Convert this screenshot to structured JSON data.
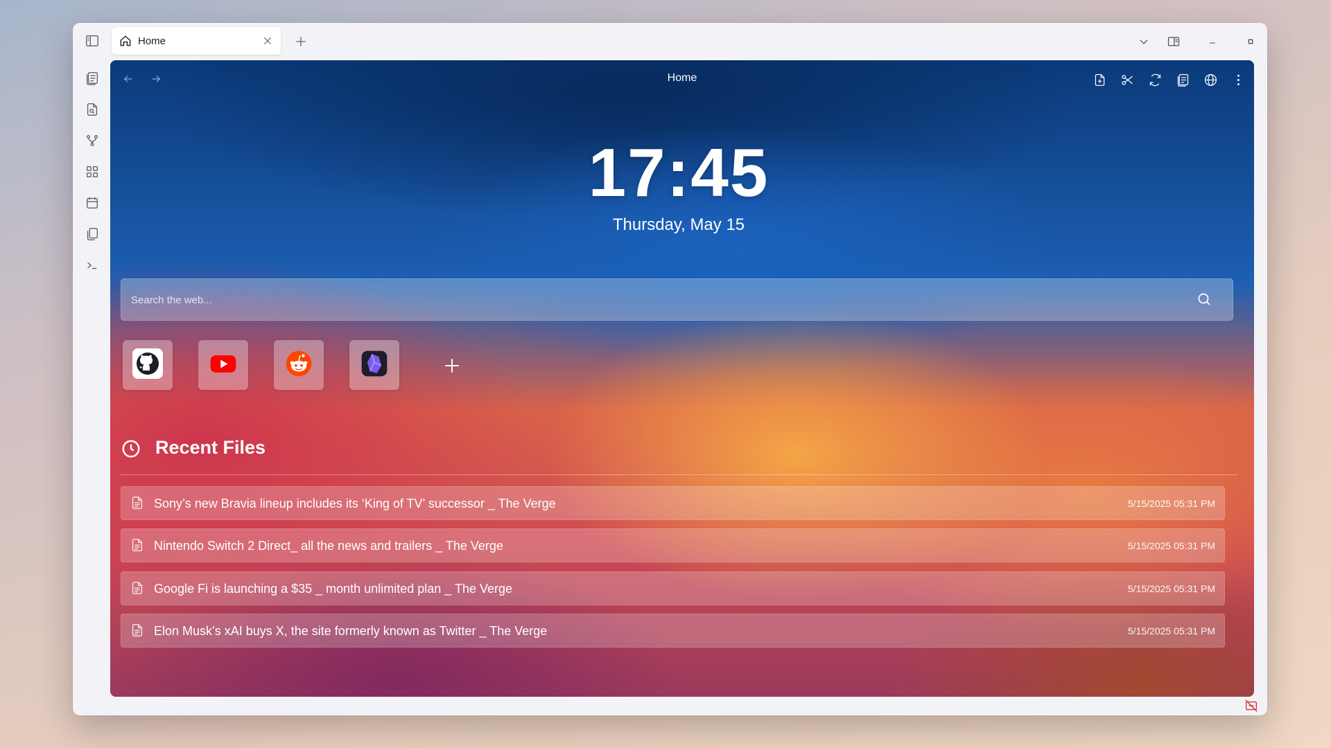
{
  "tab": {
    "title": "Home",
    "icon": "home-icon"
  },
  "toolbar": {
    "page_title": "Home",
    "tools": [
      "new-file-icon",
      "scissors-icon",
      "refresh-icon",
      "reader-icon",
      "globe-icon",
      "more-vertical-icon"
    ]
  },
  "sidebar": {
    "items": [
      "sidebar-toggle-icon",
      "notes-icon",
      "file-search-icon",
      "branch-icon",
      "apps-grid-icon",
      "calendar-icon",
      "copy-icon",
      "terminal-icon"
    ]
  },
  "clock": {
    "time": "17:45",
    "date": "Thursday, May 15"
  },
  "search": {
    "placeholder": "Search the web..."
  },
  "shortcuts": [
    {
      "name": "GitHub",
      "icon": "github-icon"
    },
    {
      "name": "YouTube",
      "icon": "youtube-icon"
    },
    {
      "name": "Reddit",
      "icon": "reddit-icon"
    },
    {
      "name": "Obsidian",
      "icon": "obsidian-icon"
    }
  ],
  "recent_files": {
    "title": "Recent Files",
    "items": [
      {
        "name": "Sony’s new Bravia lineup includes its ‘King of TV’ successor _ The Verge",
        "time": "5/15/2025 05:31 PM"
      },
      {
        "name": "Nintendo Switch 2 Direct_ all the news and trailers _ The Verge",
        "time": "5/15/2025 05:31 PM"
      },
      {
        "name": "Google Fi is launching a $35 _ month unlimited plan _ The Verge",
        "time": "5/15/2025 05:31 PM"
      },
      {
        "name": "Elon Musk’s xAI buys X, the site formerly known as Twitter _ The Verge",
        "time": "5/15/2025 05:31 PM"
      }
    ]
  },
  "colors": {
    "youtube": "#ff0000",
    "reddit": "#ff4500",
    "obsidian": "#7c5cf0",
    "status_error": "#d83a3a"
  }
}
